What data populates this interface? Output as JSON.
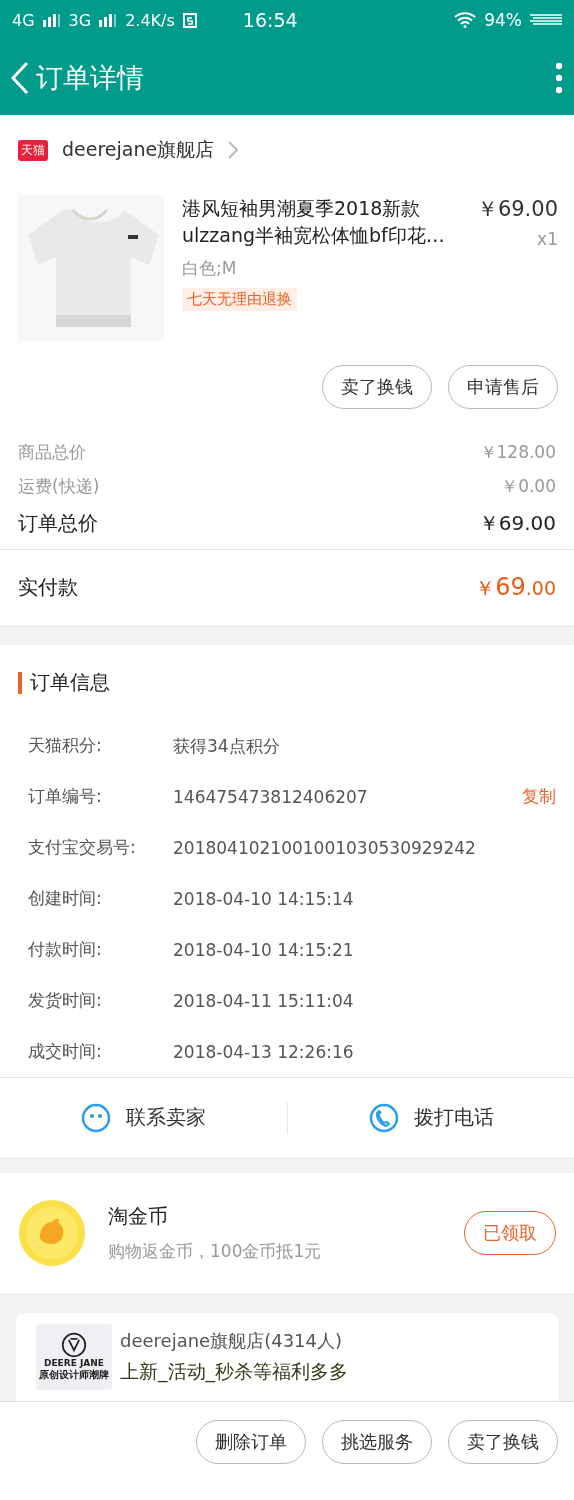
{
  "status_bar": {
    "network_1": "4G",
    "network_2": "3G",
    "speed": "2.4K/s",
    "time": "16:54",
    "battery": "94%"
  },
  "nav": {
    "title": "订单详情"
  },
  "store": {
    "badge": "天猫",
    "name": "deerejane旗舰店"
  },
  "product": {
    "kind": "picture",
    "title": "港风短袖男潮夏季2018新款ulzzang半袖宽松体恤bf印花…",
    "price": "￥69.00",
    "quantity": "x1",
    "sku": "白色;M",
    "tag": "七天无理由退换"
  },
  "item_actions": [
    "卖了换钱",
    "申请售后"
  ],
  "price_rows": [
    {
      "label": "商品总价",
      "value": "￥128.00",
      "emphasis": false
    },
    {
      "label": "运费(快递)",
      "value": "￥0.00",
      "emphasis": false
    },
    {
      "label": "订单总价",
      "value": "￥69.00",
      "emphasis": true
    }
  ],
  "paid": {
    "label": "实付款",
    "currency": "￥",
    "integer": "69",
    "decimals": ".00"
  },
  "order_info": {
    "title": "订单信息",
    "rows": [
      {
        "label": "天猫积分:",
        "value": "获得34点积分"
      },
      {
        "label": "订单编号:",
        "value": "146475473812406207",
        "action": "复制"
      },
      {
        "label": "支付宝交易号:",
        "value": "2018041021001001030530929242"
      },
      {
        "label": "创建时间:",
        "value": "2018-04-10 14:15:14"
      },
      {
        "label": "付款时间:",
        "value": "2018-04-10 14:15:21"
      },
      {
        "label": "发货时间:",
        "value": "2018-04-11 15:11:04"
      },
      {
        "label": "成交时间:",
        "value": "2018-04-13 12:26:16"
      }
    ]
  },
  "contact": [
    {
      "kind": "chat",
      "label": "联系卖家"
    },
    {
      "kind": "phone",
      "label": "拨打电话"
    }
  ],
  "coin": {
    "title": "淘金币",
    "subtitle": "购物返金币，100金币抵1元",
    "button": "已领取",
    "claimed": true
  },
  "store_card": {
    "logo_text": "DEERE JANE",
    "logo_subtext": "原创设计师潮牌",
    "name": "deerejane旗舰店(4314人)",
    "slogan": "上新_活动_秒杀等福利多多"
  },
  "bottom_actions": [
    "删除订单",
    "挑选服务",
    "卖了换钱"
  ]
}
